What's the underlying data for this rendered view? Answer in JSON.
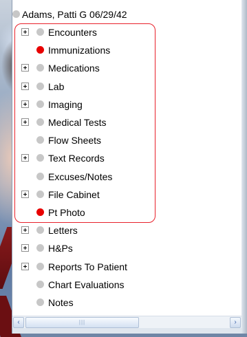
{
  "patient": {
    "label": "Adams, Patti G 06/29/42",
    "status_color": "#c7c7c7"
  },
  "tree_items": [
    {
      "label": "Encounters",
      "expandable": true,
      "status": "gray"
    },
    {
      "label": "Immunizations",
      "expandable": false,
      "status": "red"
    },
    {
      "label": "Medications",
      "expandable": true,
      "status": "gray"
    },
    {
      "label": "Lab",
      "expandable": true,
      "status": "gray"
    },
    {
      "label": "Imaging",
      "expandable": true,
      "status": "gray"
    },
    {
      "label": "Medical Tests",
      "expandable": true,
      "status": "gray"
    },
    {
      "label": "Flow Sheets",
      "expandable": false,
      "status": "gray"
    },
    {
      "label": "Text Records",
      "expandable": true,
      "status": "gray"
    },
    {
      "label": "Excuses/Notes",
      "expandable": false,
      "status": "gray"
    },
    {
      "label": "File Cabinet",
      "expandable": true,
      "status": "gray"
    },
    {
      "label": "Pt Photo",
      "expandable": false,
      "status": "red"
    },
    {
      "label": "Letters",
      "expandable": true,
      "status": "gray"
    },
    {
      "label": "H&Ps",
      "expandable": true,
      "status": "gray"
    },
    {
      "label": "Reports To Patient",
      "expandable": true,
      "status": "gray"
    },
    {
      "label": "Chart Evaluations",
      "expandable": false,
      "status": "gray"
    },
    {
      "label": "Notes",
      "expandable": false,
      "status": "gray"
    }
  ],
  "colors": {
    "status_red": "#e80000",
    "status_gray": "#c7c7c7",
    "highlight_outline": "#e8202a"
  },
  "scrollbar": {
    "left_arrow_icon": "chevron-left-icon",
    "right_arrow_icon": "chevron-right-icon",
    "thumb_grip": "grip-icon"
  }
}
